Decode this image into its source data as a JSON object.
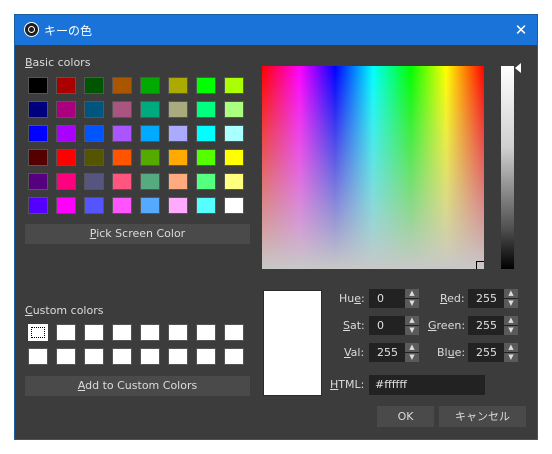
{
  "window": {
    "title": "キーの色",
    "close_glyph": "✕"
  },
  "basic": {
    "label_u": "B",
    "label_rest": "asic colors",
    "colors": [
      "#000000",
      "#aa0000",
      "#005500",
      "#aa5500",
      "#00aa00",
      "#aaaa00",
      "#00ff00",
      "#aaff00",
      "#00007f",
      "#aa007f",
      "#00557f",
      "#aa557f",
      "#00aa7f",
      "#aaaa7f",
      "#00ff7f",
      "#aaff7f",
      "#0000ff",
      "#aa00ff",
      "#0055ff",
      "#aa55ff",
      "#00aaff",
      "#aaaaff",
      "#00ffff",
      "#aaffff",
      "#550000",
      "#ff0000",
      "#555500",
      "#ff5500",
      "#55aa00",
      "#ffaa00",
      "#55ff00",
      "#ffff00",
      "#55007f",
      "#ff007f",
      "#55557f",
      "#ff557f",
      "#55aa7f",
      "#ffaa7f",
      "#55ff7f",
      "#ffff7f",
      "#5500ff",
      "#ff00ff",
      "#5555ff",
      "#ff55ff",
      "#55aaff",
      "#ffaaff",
      "#55ffff",
      "#ffffff"
    ]
  },
  "pick_button": {
    "u": "P",
    "rest": "ick Screen Color"
  },
  "custom": {
    "label_u": "C",
    "label_rest": "ustom colors",
    "colors": [
      "#ffffff",
      "#ffffff",
      "#ffffff",
      "#ffffff",
      "#ffffff",
      "#ffffff",
      "#ffffff",
      "#ffffff",
      "#ffffff",
      "#ffffff",
      "#ffffff",
      "#ffffff",
      "#ffffff",
      "#ffffff",
      "#ffffff",
      "#ffffff"
    ]
  },
  "add_button": {
    "u": "A",
    "rest": "dd to Custom Colors"
  },
  "fields": {
    "hue": {
      "label_pre": "Hu",
      "label_u": "e",
      "label_post": ":",
      "value": "0"
    },
    "sat": {
      "label_pre": "",
      "label_u": "S",
      "label_post": "at:",
      "value": "0"
    },
    "val": {
      "label_pre": "",
      "label_u": "V",
      "label_post": "al:",
      "value": "255"
    },
    "red": {
      "label_pre": "",
      "label_u": "R",
      "label_post": "ed:",
      "value": "255"
    },
    "green": {
      "label_pre": "",
      "label_u": "G",
      "label_post": "reen:",
      "value": "255"
    },
    "blue": {
      "label_pre": "Bl",
      "label_u": "u",
      "label_post": "e:",
      "value": "255"
    }
  },
  "html": {
    "label_u": "H",
    "label_rest": "TML:",
    "value": "#ffffff"
  },
  "buttons": {
    "ok": "OK",
    "cancel": "キャンセル"
  },
  "spin_glyphs": {
    "up": "▲",
    "down": "▼"
  },
  "current_color": "#ffffff"
}
